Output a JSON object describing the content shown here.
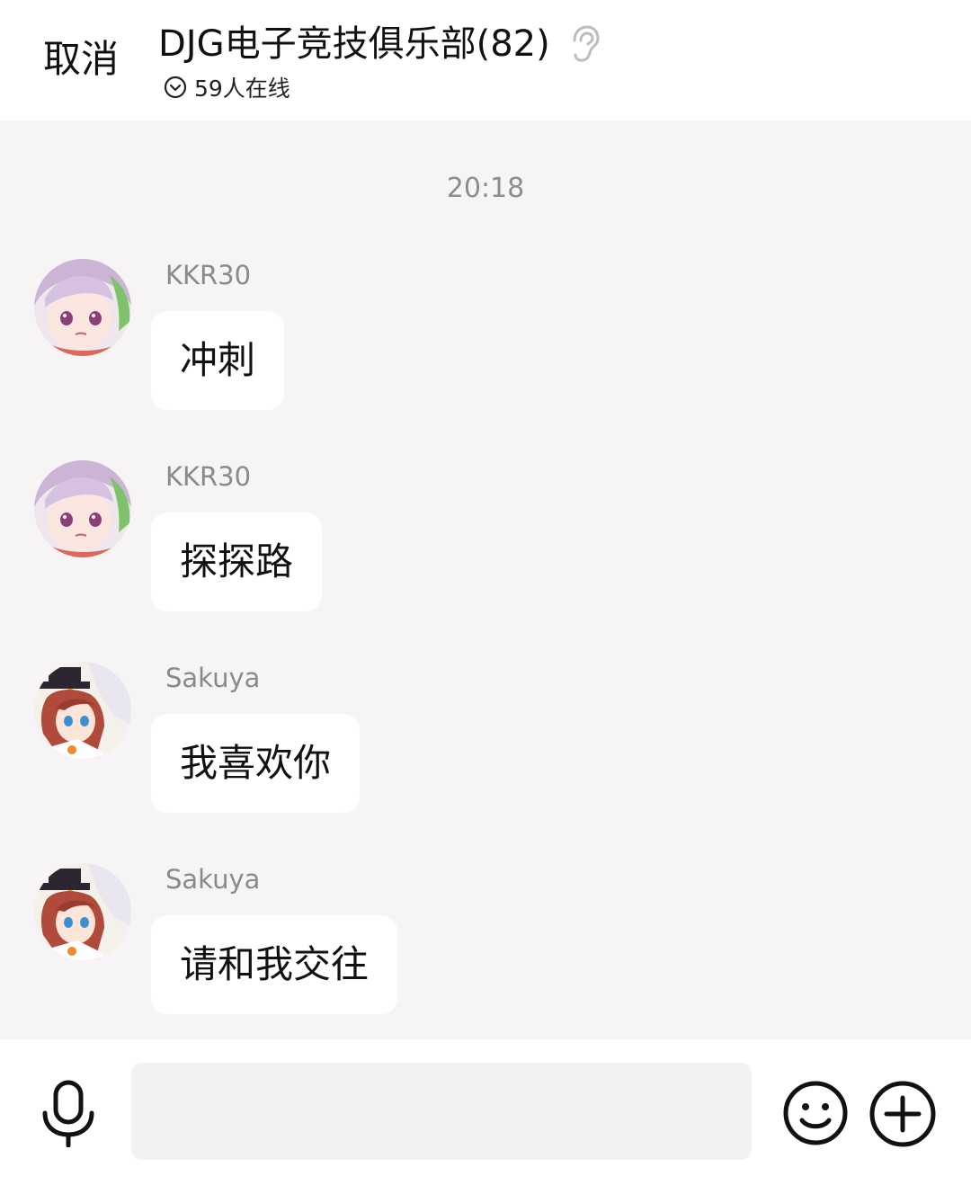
{
  "header": {
    "cancel_label": "取消",
    "title": "DJG电子竞技俱乐部(82)",
    "online_text": "59人在线"
  },
  "chat": {
    "timestamp": "20:18",
    "messages": [
      {
        "sender": "KKR30",
        "text": "冲刺",
        "avatar": "lavender-hair-anime-avatar"
      },
      {
        "sender": "KKR30",
        "text": "探探路",
        "avatar": "lavender-hair-anime-avatar"
      },
      {
        "sender": "Sakuya",
        "text": "我喜欢你",
        "avatar": "red-hair-witch-hat-anime-avatar"
      },
      {
        "sender": "Sakuya",
        "text": "请和我交往",
        "avatar": "red-hair-witch-hat-anime-avatar"
      }
    ]
  },
  "footer": {
    "input_value": "",
    "icons": [
      "microphone-icon",
      "emoji-icon",
      "plus-icon"
    ]
  },
  "colors": {
    "background": "#f6f4f5",
    "bubble": "#ffffff",
    "secondary_text": "#8a8a8a"
  }
}
